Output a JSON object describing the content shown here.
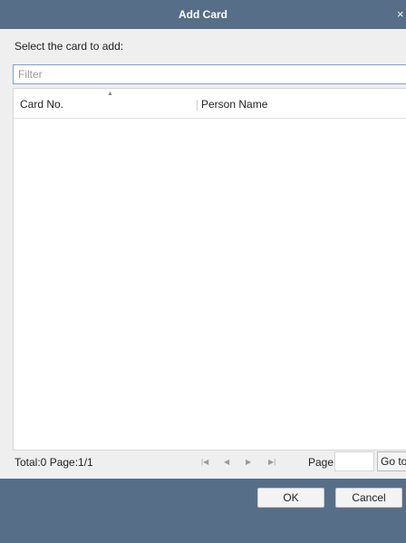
{
  "dialog": {
    "title": "Add Card",
    "close_glyph": "×",
    "instruction": "Select the card to add:",
    "filter": {
      "placeholder": "Filter",
      "value": ""
    },
    "table": {
      "columns": [
        "Card No.",
        "Person Name"
      ],
      "sorted_column": "Card No.",
      "sort_glyph": "▲",
      "rows": []
    },
    "footer": {
      "total_text": "Total:0  Page:1/1",
      "first_glyph": "|◀",
      "prev_glyph": "◀",
      "next_glyph": "▶",
      "last_glyph": "▶|",
      "page_label": "Page",
      "page_value": "",
      "goto_label": "Go to"
    },
    "buttons": {
      "ok": "OK",
      "cancel": "Cancel"
    },
    "colors": {
      "titlebar": "#566e87",
      "body": "#efefef",
      "input_border_focus": "#7aa3d6"
    }
  }
}
